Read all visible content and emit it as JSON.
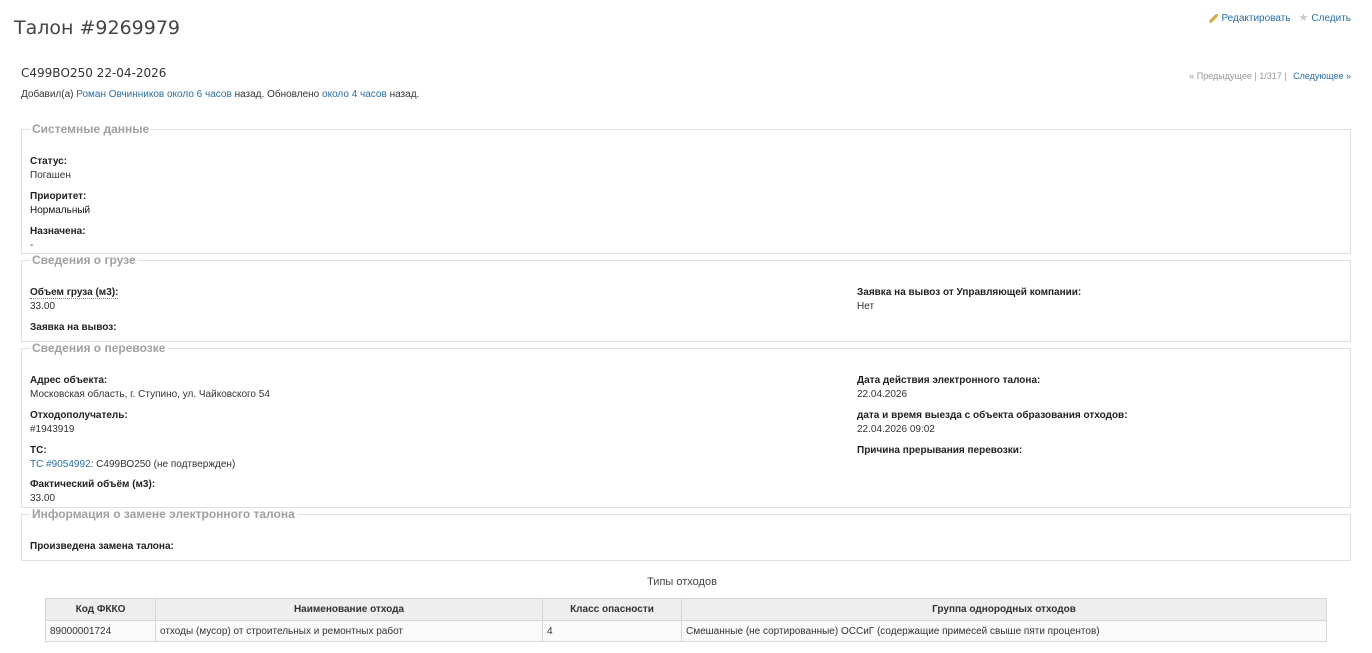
{
  "title": "Талон #9269979",
  "actions": {
    "edit": "Редактировать",
    "watch": "Следить"
  },
  "subject": "С499ВО250 22-04-2026",
  "pager": {
    "prev": "« Предыдущее",
    "sep": "|",
    "pos": "1/317",
    "sep2": "|",
    "next": "Следующее »"
  },
  "author": {
    "prefix": "Добавил(а)",
    "name": "Роман Овчинников",
    "added": "около 6 часов",
    "mid": "назад. Обновлено",
    "updated": "около 4 часов",
    "suffix": "назад."
  },
  "system": {
    "legend": "Системные данные",
    "status_label": "Статус:",
    "status": "Погашен",
    "priority_label": "Приоритет:",
    "priority": "Нормальный",
    "assigned_label": "Назначена:",
    "assigned": "-"
  },
  "cargo": {
    "legend": "Сведения о грузе",
    "volume_label": "Объем груза (м3):",
    "volume": "33.00",
    "request_label": "Заявка на вывоз:",
    "uk_label": "Заявка на вывоз от Управляющей компании:",
    "uk": "Нет"
  },
  "transport": {
    "legend": "Сведения о перевозке",
    "address_label": "Адрес объекта:",
    "address": "Московская область, г. Ступино, ул. Чайковского 54",
    "receiver_label": "Отходополучатель:",
    "receiver": "#1943919",
    "vehicle_label": "ТС:",
    "vehicle_link": "ТС #9054992",
    "vehicle_rest": ": С499ВО250 (не подтвержден)",
    "fact_label": "Фактический объём (м3):",
    "fact": "33.00",
    "date_label": "Дата действия электронного талона:",
    "date": "22.04.2026",
    "departure_label": "дата и время выезда с объекта образования отходов:",
    "departure": "22.04.2026 09:02",
    "reason_label": "Причина прерывания перевозки:"
  },
  "replace": {
    "legend": "Информация о замене электронного талона",
    "done_label": "Произведена замена талона:"
  },
  "waste": {
    "title": "Типы отходов",
    "headers": [
      "Код ФККО",
      "Наименование отхода",
      "Класс опасности",
      "Группа однородных отходов"
    ],
    "rows": [
      [
        "89000001724",
        "отходы (мусор) от строительных и ремонтных работ",
        "4",
        "Смешанные (не сортированные) ОССиГ (содержащие примесей свыше пяти процентов)"
      ]
    ]
  }
}
